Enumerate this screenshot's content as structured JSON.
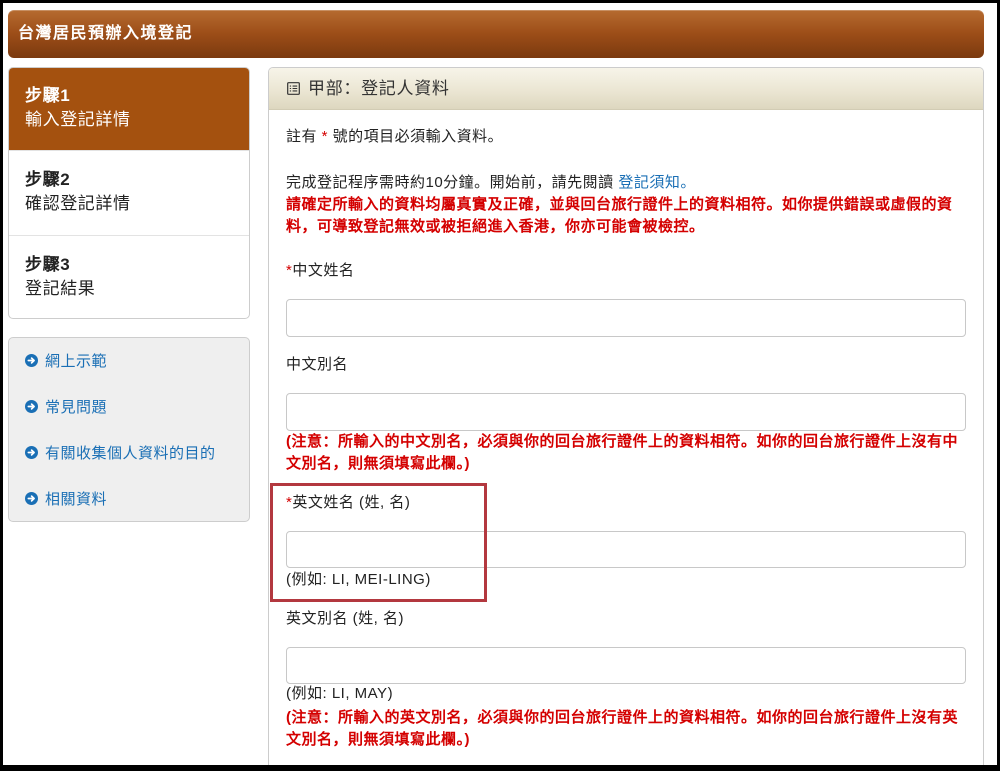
{
  "app": {
    "title": "台灣居民預辦入境登記"
  },
  "steps": [
    {
      "step": "步驟1",
      "label": "輸入登記詳情",
      "active": true
    },
    {
      "step": "步驟2",
      "label": "確認登記詳情",
      "active": false
    },
    {
      "step": "步驟3",
      "label": "登記結果",
      "active": false
    }
  ],
  "links": [
    {
      "label": "網上示範",
      "icon": "arrow-circle-right-icon"
    },
    {
      "label": "常見問題",
      "icon": "arrow-circle-right-icon"
    },
    {
      "label": "有關收集個人資料的目的",
      "icon": "arrow-circle-right-icon"
    },
    {
      "label": "相關資料",
      "icon": "arrow-circle-right-icon"
    }
  ],
  "section": {
    "icon": "form-list-icon",
    "title": "甲部：登記人資料",
    "required_note": {
      "before": "註有 ",
      "star": "*",
      "after": " 號的項目必須輸入資料。"
    },
    "intro": {
      "text": "完成登記程序需時約10分鐘。開始前，請先閱讀 ",
      "link": "登記須知",
      "end": "。"
    },
    "warning": "請確定所輸入的資料均屬真實及正確，並與回台旅行證件上的資料相符。如你提供錯誤或虛假的資料，可導致登記無效或被拒絕進入香港，你亦可能會被檢控。",
    "fields": [
      {
        "star": "*",
        "label": "中文姓名",
        "value": ""
      },
      {
        "label": "中文別名",
        "value": "",
        "note": "(注意：所輸入的中文別名，必須與你的回台旅行證件上的資料相符。如你的回台旅行證件上沒有中文別名，則無須填寫此欄。)"
      },
      {
        "star": "*",
        "label": "英文姓名 (姓, 名)",
        "value": "",
        "hint": "(例如: LI, MEI-LING)",
        "highlighted": true
      },
      {
        "label": "英文別名 (姓, 名)",
        "value": "",
        "hint": "(例如: LI, MAY)",
        "note": "(注意：所輸入的英文別名，必須與你的回台旅行證件上的資料相符。如你的回台旅行證件上沒有英文別名，則無須填寫此欄。)"
      }
    ]
  },
  "colors": {
    "brand": "#a4510f",
    "link": "#1a6fb5",
    "required": "#d40000",
    "highlight": "#b3383f"
  }
}
